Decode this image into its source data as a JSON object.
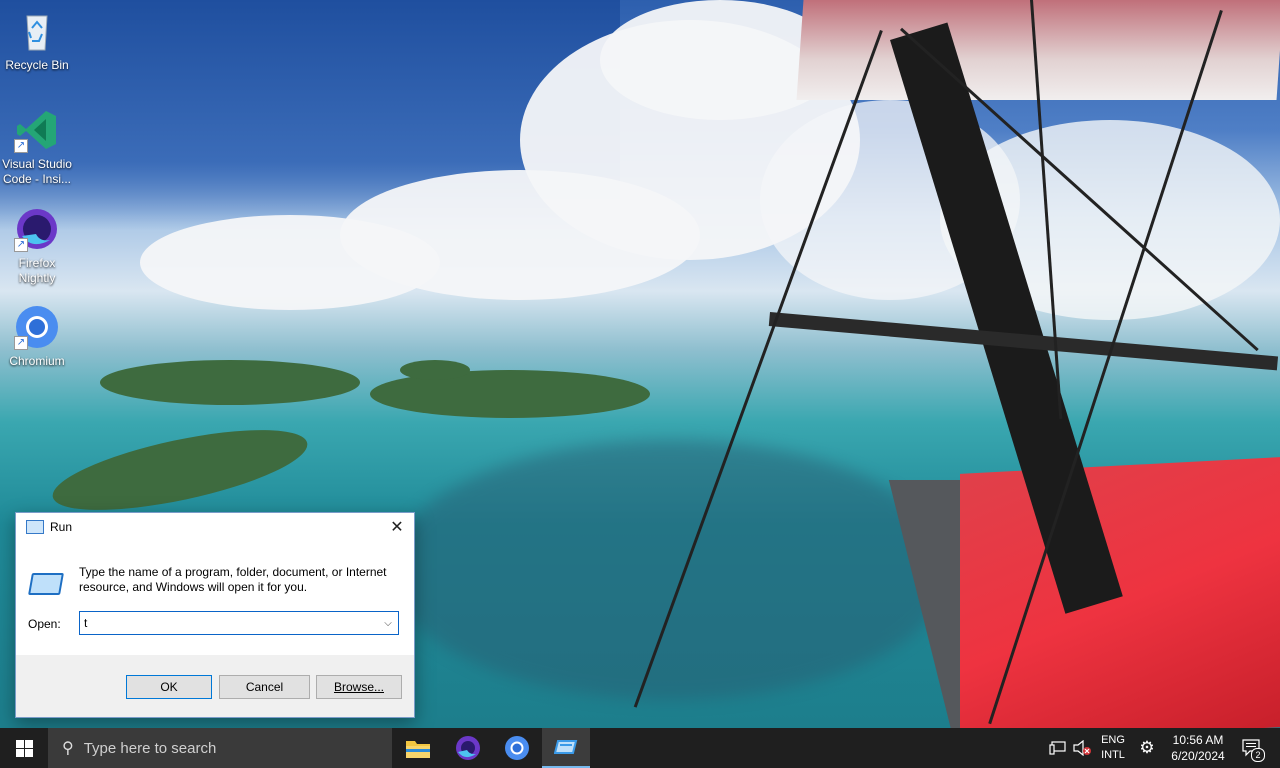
{
  "desktop": {
    "icons": [
      {
        "label": "Recycle Bin",
        "icon": "recycle-bin-icon"
      },
      {
        "label": "Visual Studio Code - Insi...",
        "icon": "vscode-insiders-icon"
      },
      {
        "label": "Firefox Nightly",
        "icon": "firefox-nightly-icon"
      },
      {
        "label": "Chromium",
        "icon": "chromium-icon"
      }
    ]
  },
  "run_dialog": {
    "title": "Run",
    "description": "Type the name of a program, folder, document, or Internet resource, and Windows will open it for you.",
    "open_label": "Open:",
    "open_value": "t",
    "ok_label": "OK",
    "cancel_label": "Cancel",
    "browse_label": "Browse..."
  },
  "taskbar": {
    "search_placeholder": "Type here to search",
    "apps": [
      "file-explorer-icon",
      "firefox-nightly-icon",
      "chromium-icon",
      "run-icon"
    ],
    "language_line1": "ENG",
    "language_line2": "INTL",
    "time": "10:56 AM",
    "date": "6/20/2024",
    "notification_count": "2"
  },
  "colors": {
    "taskbar_bg": "#1f1f1f",
    "accent": "#0078d7",
    "wing_red": "#ee3340"
  }
}
